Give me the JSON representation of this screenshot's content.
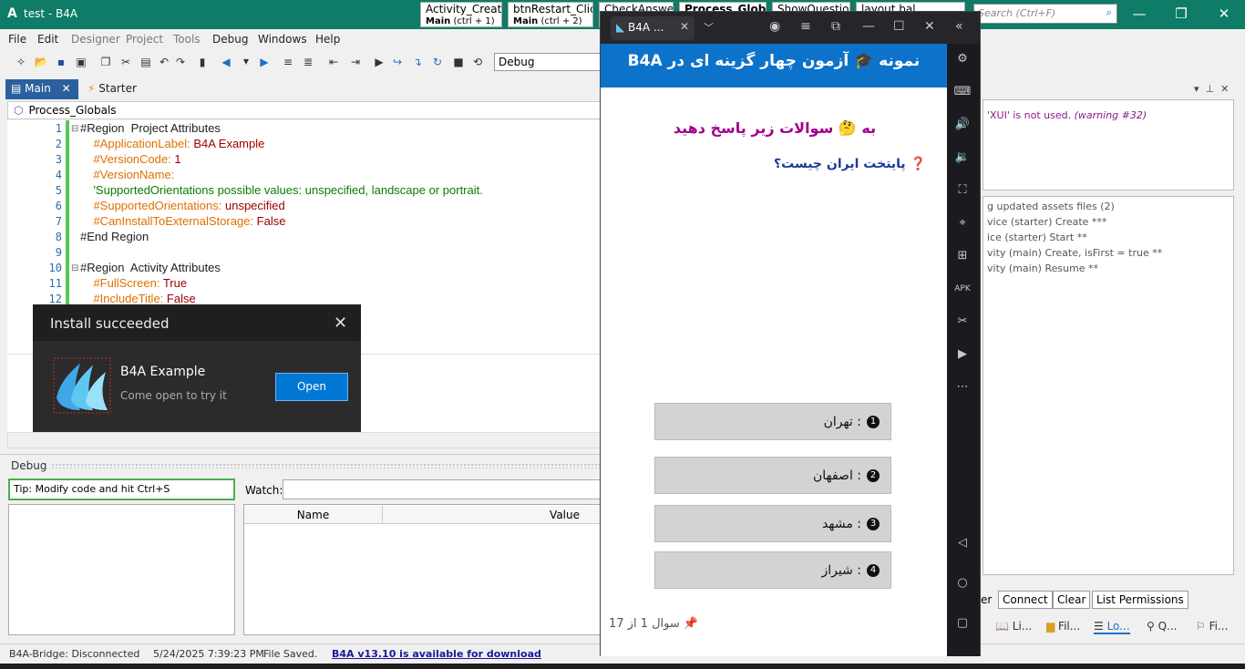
{
  "window": {
    "app_icon": "A",
    "title": "test - B4A"
  },
  "quick_tabs": [
    {
      "name": "Activity_Create",
      "sub_module": "Main",
      "sub_key": "(ctrl + 1)"
    },
    {
      "name": "btnRestart_Click",
      "sub_module": "Main",
      "sub_key": "(ctrl + 2)"
    },
    {
      "name": "CheckAnswer"
    },
    {
      "name": "Process_Globals"
    },
    {
      "name": "ShowQuestion"
    },
    {
      "name": "layout.bal"
    }
  ],
  "search": {
    "placeholder": "Search (Ctrl+F)"
  },
  "window_controls": {
    "minimize": "—",
    "restore": "❐",
    "close": "✕"
  },
  "menu": [
    "File",
    "Edit",
    "Designer",
    "Project",
    "Tools",
    "Debug",
    "Windows",
    "Help"
  ],
  "toolbar": {
    "build_config": "Debug"
  },
  "tabs": [
    {
      "label": "Main"
    },
    {
      "label": "Starter"
    }
  ],
  "breadcrumb": "Process_Globals",
  "code_lines": [
    {
      "n": "1",
      "fold": "⊟",
      "parts": [
        {
          "t": "#Region  Project Attributes",
          "c": "kw"
        }
      ]
    },
    {
      "n": "2",
      "parts": [
        {
          "t": "    #ApplicationLabel: ",
          "c": "attr"
        },
        {
          "t": "B4A Example",
          "c": "val"
        }
      ]
    },
    {
      "n": "3",
      "parts": [
        {
          "t": "    #VersionCode: ",
          "c": "attr"
        },
        {
          "t": "1",
          "c": "val"
        }
      ]
    },
    {
      "n": "4",
      "parts": [
        {
          "t": "    #VersionName: ",
          "c": "attr"
        }
      ]
    },
    {
      "n": "5",
      "parts": [
        {
          "t": "    'SupportedOrientations possible values: unspecified, landscape or portrait.",
          "c": "cmt"
        }
      ]
    },
    {
      "n": "6",
      "parts": [
        {
          "t": "    #SupportedOrientations: ",
          "c": "attr"
        },
        {
          "t": "unspecified",
          "c": "val"
        }
      ]
    },
    {
      "n": "7",
      "parts": [
        {
          "t": "    #CanInstallToExternalStorage: ",
          "c": "attr"
        },
        {
          "t": "False",
          "c": "val"
        }
      ]
    },
    {
      "n": "8",
      "parts": [
        {
          "t": "#End Region",
          "c": "kw"
        }
      ]
    },
    {
      "n": "9",
      "parts": []
    },
    {
      "n": "10",
      "fold": "⊟",
      "parts": [
        {
          "t": "#Region  Activity Attributes",
          "c": "kw"
        }
      ]
    },
    {
      "n": "11",
      "parts": [
        {
          "t": "    #FullScreen: ",
          "c": "attr"
        },
        {
          "t": "True",
          "c": "val"
        }
      ]
    },
    {
      "n": "12",
      "parts": [
        {
          "t": "    #IncludeTitle: ",
          "c": "attr"
        },
        {
          "t": "False",
          "c": "val"
        }
      ]
    }
  ],
  "toast": {
    "title": "Install succeeded",
    "close": "✕",
    "app_name": "B4A Example",
    "subtitle": "Come open to try it",
    "open_label": "Open"
  },
  "debug": {
    "title": "Debug",
    "tip": "Tip: Modify code and hit Ctrl+S",
    "watch_label": "Watch:",
    "columns": [
      "Name",
      "Value"
    ]
  },
  "status": {
    "bridge": "B4A-Bridge: Disconnected",
    "timestamp": "5/24/2025 7:39:23 PM",
    "saved": "File Saved.",
    "update": "B4A v13.10 is available for download"
  },
  "right_panel": {
    "warning_text": "'XUI' is not used.",
    "warning_code": "(warning #32)",
    "log_lines": [
      "g updated assets files (2)",
      "vice (starter) Create ***",
      "ice (starter) Start **",
      "vity (main) Create, isFirst = true **",
      "vity (main) Resume **"
    ],
    "buttons": {
      "partial": "er",
      "connect": "Connect",
      "clear": "Clear",
      "permissions": "List Permissions"
    },
    "tabs": [
      "Li...",
      "Fil...",
      "Lo...",
      "Q...",
      "Fi..."
    ]
  },
  "emulator": {
    "tab_label": "B4A ...",
    "header": "نمونه 🎓 آزمون  چهار گزینه ای در B4A",
    "welcome": "به 🤔 سوالات زیر پاسخ دهید",
    "question": "❓ پایتخت ایران چیست؟",
    "options": [
      {
        "num": "1",
        "text": ": تهران"
      },
      {
        "num": "2",
        "text": ": اصفهان"
      },
      {
        "num": "3",
        "text": ": مشهد"
      },
      {
        "num": "4",
        "text": ": شیراز"
      }
    ],
    "footer": "📌 سوال 1 از 17"
  }
}
